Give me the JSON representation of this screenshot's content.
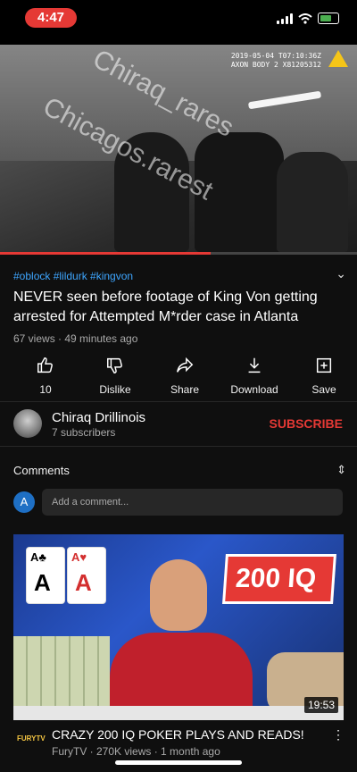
{
  "status_bar": {
    "time": "4:47"
  },
  "video": {
    "watermark_1": "Chiraq_rares",
    "watermark_2": "Chicagos.rarest",
    "camera_line_1": "2019-05-04 T07:10:36Z",
    "camera_line_2": "AXON BODY 2 X81205312",
    "progress": 0.59
  },
  "details": {
    "tags": "#oblock #lildurk #kingvon",
    "title": "NEVER seen before footage of King Von getting arrested for Attempted M*rder case in Atlanta",
    "meta": "67 views · 49 minutes ago"
  },
  "actions": [
    {
      "label": "10",
      "icon": "thumbs-up-icon"
    },
    {
      "label": "Dislike",
      "icon": "thumbs-down-icon"
    },
    {
      "label": "Share",
      "icon": "share-icon"
    },
    {
      "label": "Download",
      "icon": "download-icon"
    },
    {
      "label": "Save",
      "icon": "save-icon"
    }
  ],
  "channel": {
    "name": "Chiraq Drillinois",
    "subscribers": "7 subscribers",
    "subscribe_label": "SUBSCRIBE"
  },
  "comments": {
    "heading": "Comments",
    "avatar_letter": "A",
    "placeholder": "Add a comment..."
  },
  "recommended": {
    "thumb_badge": "200 IQ",
    "card_1": "A",
    "card_2": "A",
    "duration": "19:53",
    "channel_logo": "FURYTV",
    "title": "CRAZY 200 IQ POKER PLAYS AND READS!",
    "meta": "FuryTV · 270K views · 1 month ago"
  },
  "colors": {
    "accent": "#e53935",
    "link": "#3ea6ff",
    "background": "#0f0f0f"
  }
}
